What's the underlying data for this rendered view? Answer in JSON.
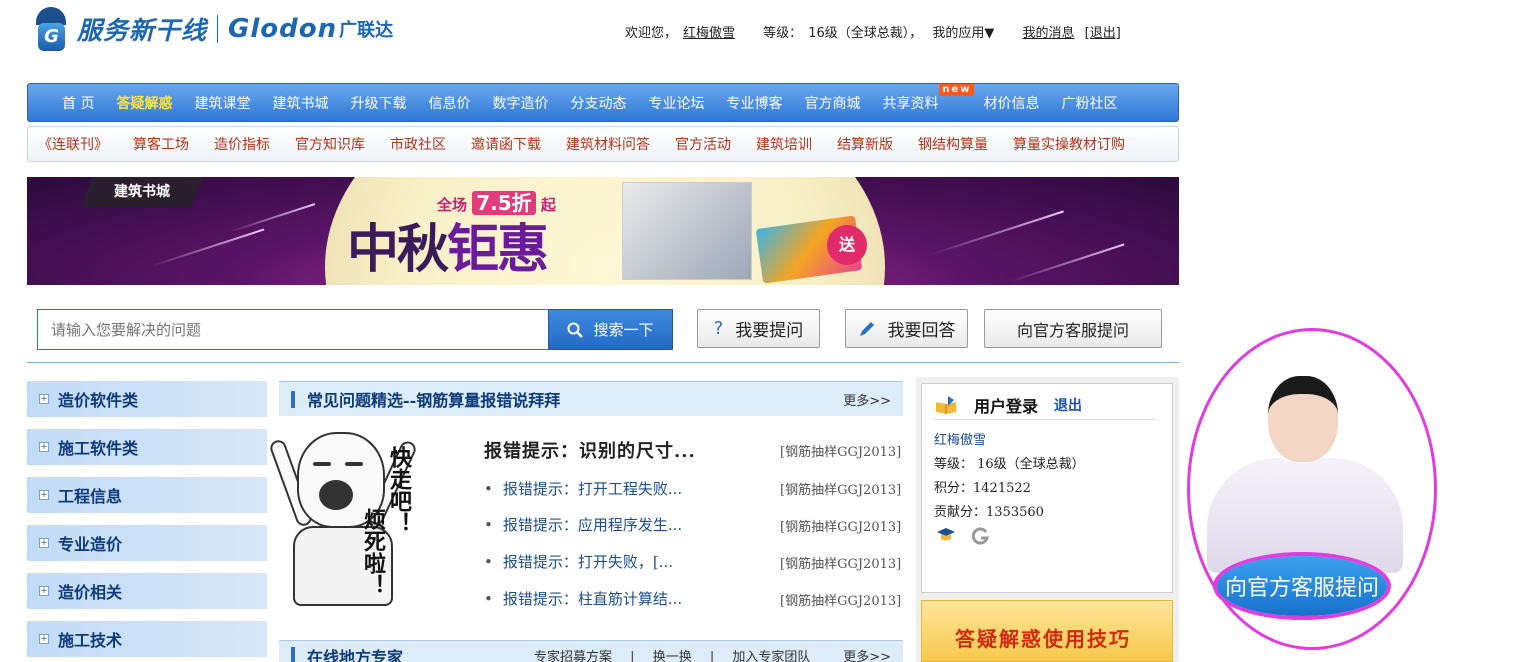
{
  "header": {
    "logo_cn": "服务新干线",
    "logo_en": "Glodon",
    "logo_en_cn": "广联达",
    "greeting": "欢迎您，",
    "username": "红梅傲雪",
    "level_label": "等级：",
    "level_value": "16级（全球总裁），",
    "my_apps": "我的应用▼",
    "messages": "我的消息",
    "logout": "[退出]"
  },
  "nav1": {
    "items": [
      "首 页",
      "答疑解惑",
      "建筑课堂",
      "建筑书城",
      "升级下载",
      "信息价",
      "数字造价",
      "分支动态",
      "专业论坛",
      "专业博客",
      "官方商城",
      "共享资料",
      "材价信息",
      "广粉社区"
    ],
    "new_badge": "new"
  },
  "nav2": {
    "items": [
      "《连联刊》",
      "算客工场",
      "造价指标",
      "官方知识库",
      "市政社区",
      "邀请函下载",
      "建筑材料问答",
      "官方活动",
      "建筑培训",
      "结算新版",
      "钢结构算量",
      "算量实操教材订购"
    ]
  },
  "banner": {
    "tag": "建筑书城",
    "promo_prefix": "全场",
    "promo_discount": "7.5折",
    "promo_suffix": "起",
    "title_part1": "中秋",
    "title_part2": "钜惠",
    "gift": "送"
  },
  "search": {
    "placeholder": "请输入您要解决的问题",
    "button": "搜索一下",
    "ask": "我要提问",
    "answer": "我要回答",
    "service": "向官方客服提问"
  },
  "sidebar": {
    "items": [
      "造价软件类",
      "施工软件类",
      "工程信息",
      "专业造价",
      "造价相关",
      "施工技术"
    ]
  },
  "faq_panel": {
    "title": "常见问题精选--钢筋算量报错说拜拜",
    "more": "更多>>",
    "meme_text_1": "快走吧！",
    "meme_text_2": "烦死啦！",
    "top_item": "报错提示：识别的尺寸...",
    "items": [
      {
        "text": "报错提示：打开工程失败...",
        "tag": "[钢筋抽样GGJ2013]"
      },
      {
        "text": "报错提示：应用程序发生...",
        "tag": "[钢筋抽样GGJ2013]"
      },
      {
        "text": "报错提示：打开失败，[...",
        "tag": "[钢筋抽样GGJ2013]"
      },
      {
        "text": "报错提示：柱直筋计算结...",
        "tag": "[钢筋抽样GGJ2013]"
      }
    ],
    "top_tag": "[钢筋抽样GGJ2013]"
  },
  "expert_panel": {
    "title": "在线地方专家",
    "links": [
      "专家招募方案",
      "|",
      "换一换",
      "|",
      "加入专家团队"
    ],
    "more": "更多>>"
  },
  "login": {
    "title": "用户登录",
    "logout": "退出",
    "name": "红梅傲雪",
    "level": "等级： 16级（全球总裁）",
    "points": "积分：1421522",
    "contribution": "贡献分：1353560"
  },
  "tips": {
    "title": "答疑解惑使用技巧"
  },
  "agent": {
    "button": "向官方客服提问"
  }
}
